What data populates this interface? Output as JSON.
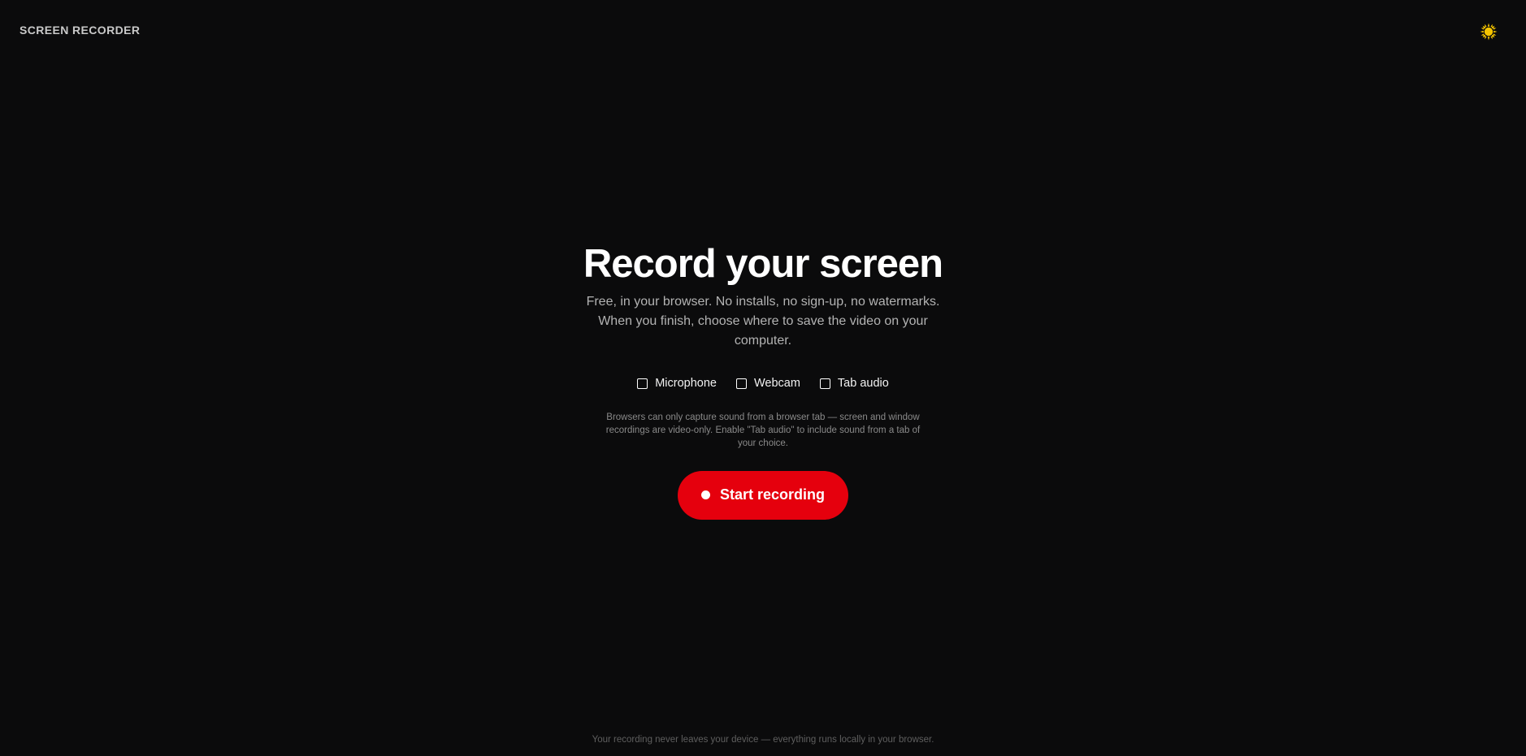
{
  "header": {
    "brand": "SCREEN RECORDER",
    "theme_toggle_icon": "sun-icon",
    "theme_toggle_color": "#f5c400"
  },
  "main": {
    "title": "Record your screen",
    "subtitle": "Free, in your browser. No installs, no sign-up, no watermarks. When you finish, choose where to save the video on your computer.",
    "options": [
      {
        "label": "Microphone",
        "checked": false
      },
      {
        "label": "Webcam",
        "checked": false
      },
      {
        "label": "Tab audio",
        "checked": false
      }
    ],
    "note": "Browsers can only capture sound from a browser tab — screen and window recordings are video-only. Enable \"Tab audio\" to include sound from a tab of your choice.",
    "record_button": {
      "label": "Start recording",
      "icon": "record-dot-icon",
      "color": "#e5000d"
    }
  },
  "footer": {
    "text": "Your recording never leaves your device — everything runs locally in your browser."
  }
}
